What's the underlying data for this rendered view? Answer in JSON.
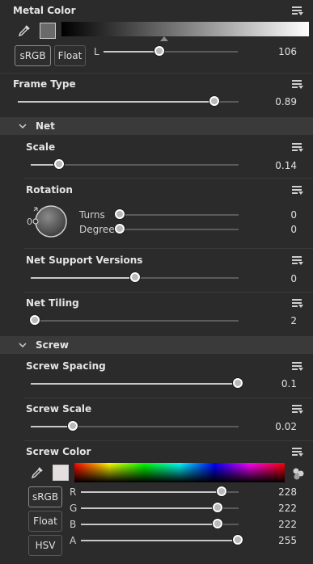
{
  "metal_color": {
    "title": "Metal Color",
    "srgb_label": "sRGB",
    "float_label": "Float",
    "l_label": "L",
    "l_value": "106",
    "l_level": 106,
    "swatch_color": "#6a6a6a"
  },
  "frame_type": {
    "title": "Frame Type",
    "value": "0.89",
    "level": 0.89
  },
  "net": {
    "section_label": "Net",
    "scale": {
      "title": "Scale",
      "value": "0.14",
      "level": 0.14
    },
    "rotation": {
      "title": "Rotation",
      "dial_zero": "0",
      "turns_label": "Turns",
      "turns_value": "0",
      "degrees_label": "Degrees",
      "degrees_value": "0"
    },
    "support_versions": {
      "title": "Net Support Versions",
      "value": "0"
    },
    "tiling": {
      "title": "Net Tiling",
      "value": "2"
    }
  },
  "screw": {
    "section_label": "Screw",
    "spacing": {
      "title": "Screw Spacing",
      "value": "0.1"
    },
    "scale": {
      "title": "Screw Scale",
      "value": "0.02"
    },
    "color": {
      "title": "Screw Color",
      "swatch_color": "#e4dede",
      "srgb_label": "sRGB",
      "float_label": "Float",
      "hsv_label": "HSV",
      "r_label": "R",
      "r_value": "228",
      "r_level": 228,
      "g_label": "G",
      "g_value": "222",
      "g_level": 222,
      "b_label": "B",
      "b_value": "222",
      "b_level": 222,
      "a_label": "A",
      "a_value": "255",
      "a_level": 255
    }
  },
  "icons": [
    "eyedropper-icon",
    "menu-icon",
    "chevron-down-icon",
    "palette-icon",
    "rotation-dial-icon"
  ]
}
